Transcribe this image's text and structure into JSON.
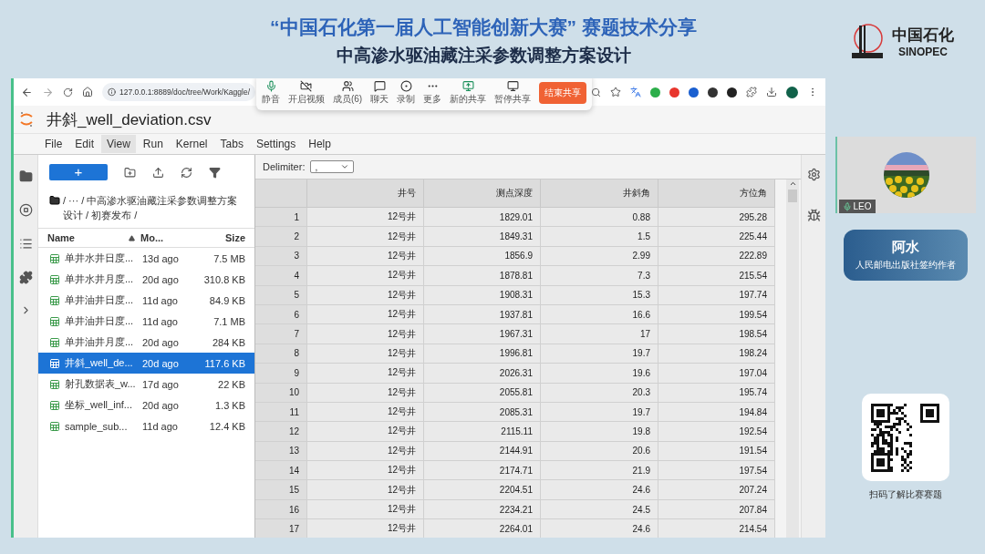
{
  "header": {
    "title": "“中国石化第一届人工智能创新大赛” 赛题技术分享",
    "subtitle": "中高渗水驱油藏注采参数调整方案设计"
  },
  "logo": {
    "name": "中国石化",
    "latin": "SINOPEC"
  },
  "browser": {
    "url": "127.0.0.1:8889/doc/tree/Work/Kaggle/"
  },
  "meeting_toolbar": {
    "buttons": [
      {
        "label": "静音",
        "kind": "mic"
      },
      {
        "label": "开启视频",
        "kind": "video"
      },
      {
        "label": "成员(6)",
        "kind": "members"
      },
      {
        "label": "聊天",
        "kind": "chat"
      },
      {
        "label": "录制",
        "kind": "record"
      },
      {
        "label": "更多",
        "kind": "more"
      },
      {
        "label": "新的共享",
        "kind": "share"
      },
      {
        "label": "暂停共享",
        "kind": "pause"
      }
    ],
    "end_button": "结束共享"
  },
  "jupyter": {
    "title": "井斜_well_deviation.csv",
    "menu": [
      {
        "label": "File",
        "selected": false
      },
      {
        "label": "Edit",
        "selected": false
      },
      {
        "label": "View",
        "selected": true
      },
      {
        "label": "Run",
        "selected": false
      },
      {
        "label": "Kernel",
        "selected": false
      },
      {
        "label": "Tabs",
        "selected": false
      },
      {
        "label": "Settings",
        "selected": false
      },
      {
        "label": "Help",
        "selected": false
      }
    ],
    "new_button": "+",
    "breadcrumb": "/ ··· / 中高渗水驱油藏注采参数调整方案设计 / 初赛发布 /",
    "file_columns": [
      "Name",
      "Mo...",
      "Size"
    ],
    "files": [
      {
        "name": "单井水井日度...",
        "modified": "13d ago",
        "size": "7.5 MB",
        "selected": false
      },
      {
        "name": "单井水井月度...",
        "modified": "20d ago",
        "size": "310.8 KB",
        "selected": false
      },
      {
        "name": "单井油井日度...",
        "modified": "11d ago",
        "size": "84.9 KB",
        "selected": false
      },
      {
        "name": "单井油井日度...",
        "modified": "11d ago",
        "size": "7.1 MB",
        "selected": false
      },
      {
        "name": "单井油井月度...",
        "modified": "20d ago",
        "size": "284 KB",
        "selected": false
      },
      {
        "name": "井斜_well_de...",
        "modified": "20d ago",
        "size": "117.6 KB",
        "selected": true
      },
      {
        "name": "射孔数据表_w...",
        "modified": "17d ago",
        "size": "22 KB",
        "selected": false
      },
      {
        "name": "坐标_well_inf...",
        "modified": "20d ago",
        "size": "1.3 KB",
        "selected": false
      },
      {
        "name": "sample_sub...",
        "modified": "11d ago",
        "size": "12.4 KB",
        "selected": false
      }
    ],
    "delimiter_label": "Delimiter:",
    "delimiter": ",",
    "table": {
      "columns": [
        "",
        "井号",
        "测点深度",
        "井斜角",
        "方位角"
      ],
      "rows": [
        [
          "1",
          "12号井",
          "1829.01",
          "0.88",
          "295.28"
        ],
        [
          "2",
          "12号井",
          "1849.31",
          "1.5",
          "225.44"
        ],
        [
          "3",
          "12号井",
          "1856.9",
          "2.99",
          "222.89"
        ],
        [
          "4",
          "12号井",
          "1878.81",
          "7.3",
          "215.54"
        ],
        [
          "5",
          "12号井",
          "1908.31",
          "15.3",
          "197.74"
        ],
        [
          "6",
          "12号井",
          "1937.81",
          "16.6",
          "199.54"
        ],
        [
          "7",
          "12号井",
          "1967.31",
          "17",
          "198.54"
        ],
        [
          "8",
          "12号井",
          "1996.81",
          "19.7",
          "198.24"
        ],
        [
          "9",
          "12号井",
          "2026.31",
          "19.6",
          "197.04"
        ],
        [
          "10",
          "12号井",
          "2055.81",
          "20.3",
          "195.74"
        ],
        [
          "11",
          "12号井",
          "2085.31",
          "19.7",
          "194.84"
        ],
        [
          "12",
          "12号井",
          "2115.11",
          "19.8",
          "192.54"
        ],
        [
          "13",
          "12号井",
          "2144.91",
          "20.6",
          "191.54"
        ],
        [
          "14",
          "12号井",
          "2174.71",
          "21.9",
          "197.54"
        ],
        [
          "15",
          "12号井",
          "2204.51",
          "24.6",
          "207.24"
        ],
        [
          "16",
          "12号井",
          "2234.21",
          "24.5",
          "207.84"
        ],
        [
          "17",
          "12号井",
          "2264.01",
          "24.6",
          "214.54"
        ]
      ]
    }
  },
  "speaker": {
    "label": "LEO"
  },
  "presenter": {
    "name": "阿水",
    "role": "人民邮电出版社签约作者"
  },
  "qr": {
    "caption": "扫码了解比赛赛题"
  }
}
